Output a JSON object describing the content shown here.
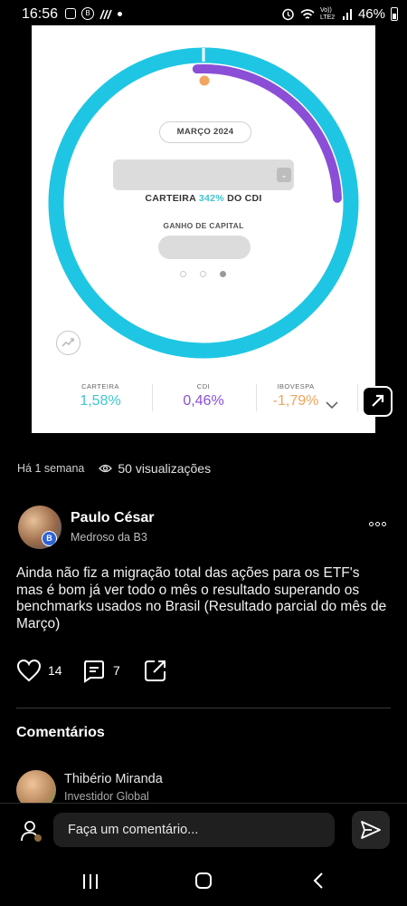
{
  "status_bar": {
    "time": "16:56",
    "network": "Vo)) LTE2",
    "battery": "46%"
  },
  "card": {
    "month": "MARÇO 2024",
    "cdi_prefix": "CARTEIRA",
    "cdi_pct": "342%",
    "cdi_suffix": "DO CDI",
    "gain_label": "GANHO DE CAPITAL",
    "stats": [
      {
        "label": "CARTEIRA",
        "value": "1,58%",
        "color": "#3ec5cf"
      },
      {
        "label": "CDI",
        "value": "0,46%",
        "color": "#8a4fd6"
      },
      {
        "label": "IBOVESPA",
        "value": "-1,79%",
        "color": "#f0a35a"
      }
    ],
    "colors": {
      "ring": "#1fc6e3",
      "progress": "#8a4fd6",
      "marker": "#f2a560"
    }
  },
  "post": {
    "time_ago": "Há 1 semana",
    "views": "50 visualizações",
    "author_name": "Paulo César",
    "author_subtitle": "Medroso da B3",
    "text": "Ainda não fiz a migração total das ações para os ETF's mas é bom já ver todo o mês o resultado superando os benchmarks usados no Brasil (Resultado parcial do mês de Março)",
    "likes": "14",
    "comments": "7"
  },
  "comments": {
    "title": "Comentários",
    "first": {
      "name": "Thibério Miranda",
      "subtitle": "Investidor Global"
    }
  },
  "composer": {
    "placeholder": "Faça um comentário..."
  }
}
